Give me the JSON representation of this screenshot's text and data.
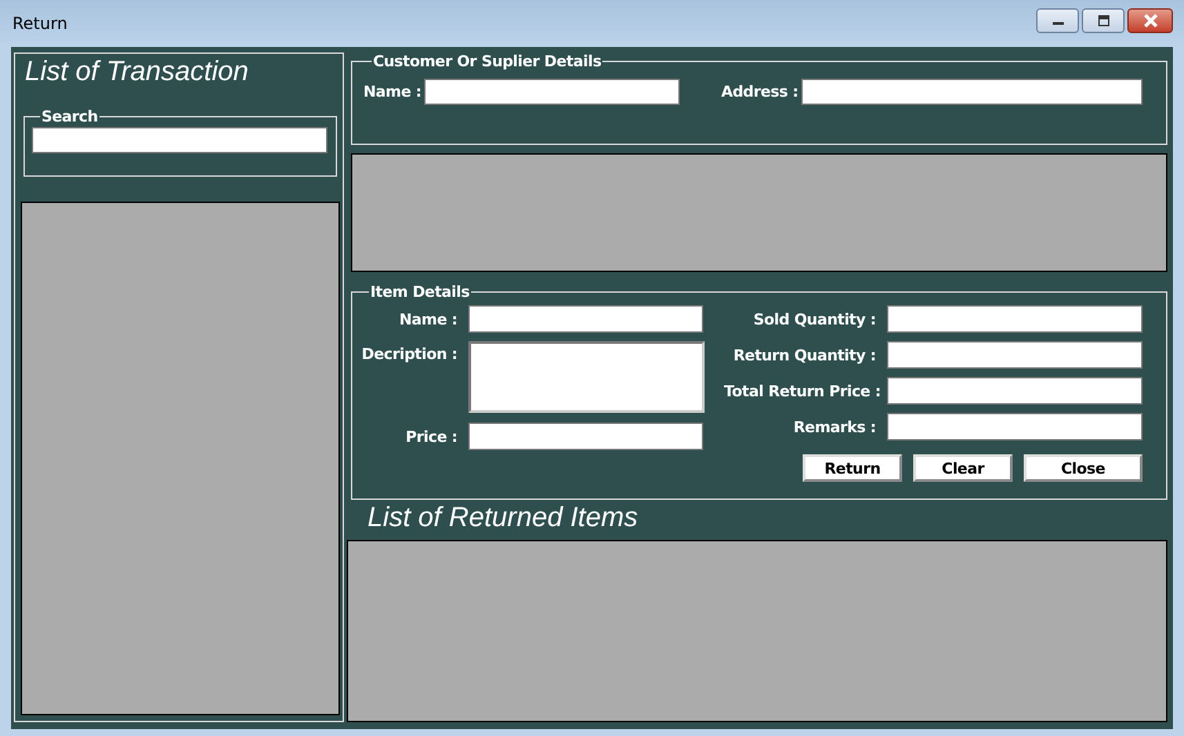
{
  "window": {
    "title": "Return"
  },
  "transactions": {
    "title": "List of Transaction",
    "search_label": "Search"
  },
  "customer": {
    "legend": "Customer Or Suplier Details",
    "fields": [
      {
        "label": "Name :"
      },
      {
        "label": "Address :"
      }
    ]
  },
  "item_details": {
    "legend": "Item Details",
    "left_fields": [
      {
        "label": "Name :",
        "kind": "line"
      },
      {
        "label": "Decription :",
        "kind": "multiline"
      },
      {
        "label": "Price :",
        "kind": "line"
      }
    ],
    "right_fields": [
      {
        "label": "Sold Quantity :"
      },
      {
        "label": "Return Quantity :"
      },
      {
        "label": "Total Return Price :"
      },
      {
        "label": "Remarks :"
      }
    ],
    "buttons": [
      "Return",
      "Clear",
      "Close"
    ]
  },
  "returned": {
    "title": "List of Returned Items"
  }
}
